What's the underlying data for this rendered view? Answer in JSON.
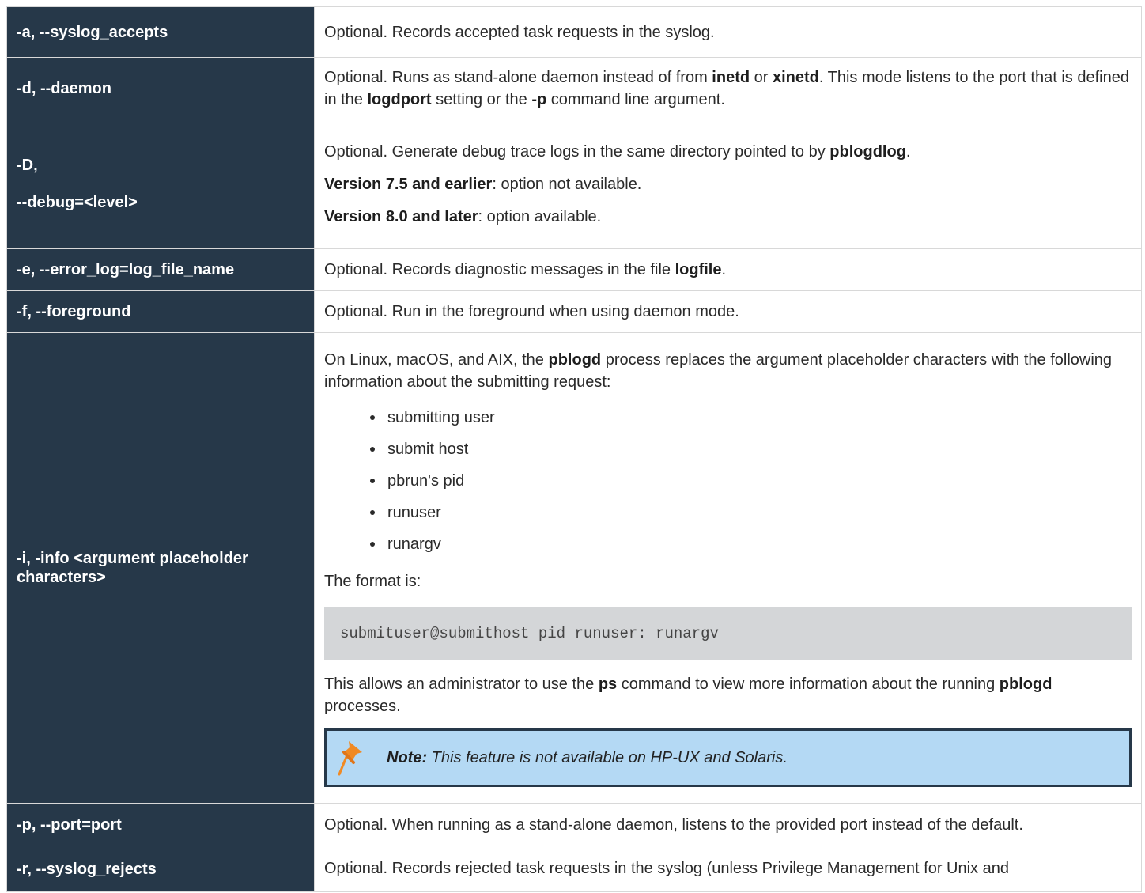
{
  "rows": [
    {
      "key": "-a, --syslog_accepts",
      "desc": "Optional. Records accepted task requests in the syslog."
    },
    {
      "key": "-d, --daemon",
      "desc": {
        "t1": "Optional. Runs as stand-alone daemon instead of from ",
        "b1": "inetd",
        "t2": " or ",
        "b2": "xinetd",
        "t3": ". This mode listens to the port that is defined in the ",
        "b3": "logdport",
        "t4": " setting or the ",
        "b4": "-p",
        "t5": " command line argument."
      }
    },
    {
      "key1": "-D,",
      "key2": "--debug=<level>",
      "p1": {
        "t1": "Optional. Generate debug trace logs in the same directory pointed to by ",
        "b1": "pblogdlog",
        "t2": "."
      },
      "p2": {
        "b1": "Version 7.5 and earlier",
        "t1": ": option not available."
      },
      "p3": {
        "b1": "Version 8.0 and later",
        "t1": ": option available."
      }
    },
    {
      "key": "-e, --error_log=log_file_name",
      "desc": {
        "t1": "Optional. Records diagnostic messages in the file ",
        "b1": "logfile",
        "t2": "."
      }
    },
    {
      "key": "-f, --foreground",
      "desc": "Optional. Run in the foreground when using daemon mode."
    },
    {
      "key": "-i, -info <argument placeholder characters>",
      "intro": {
        "t1": "On Linux, macOS, and AIX, the ",
        "b1": "pblogd",
        "t2": " process replaces the argument placeholder characters with the following information about the submitting request:"
      },
      "bullets": [
        "submitting user",
        "submit host",
        "pbrun's pid",
        "runuser",
        "runargv"
      ],
      "format_label": "The format is:",
      "code": "submituser@submithost pid runuser: runargv",
      "after": {
        "t1": "This allows an administrator to use the ",
        "b1": "ps",
        "t2": " command to view more information about the running ",
        "b2": "pblogd",
        "t3": " processes."
      },
      "note": {
        "icon": "pushpin-icon",
        "label": "Note:",
        "text": " This feature is not available on HP-UX and Solaris."
      }
    },
    {
      "key": "-p, --port=port",
      "desc": "Optional. When running as a stand-alone daemon, listens to the provided port instead of the default."
    },
    {
      "key": "-r, --syslog_rejects",
      "desc": "Optional. Records rejected task requests in the syslog (unless Privilege Management for Unix and"
    }
  ],
  "colors": {
    "key_background": "#263849",
    "code_background": "#d4d6d8",
    "note_background": "#b4d9f4",
    "pin": "#f08a24"
  }
}
